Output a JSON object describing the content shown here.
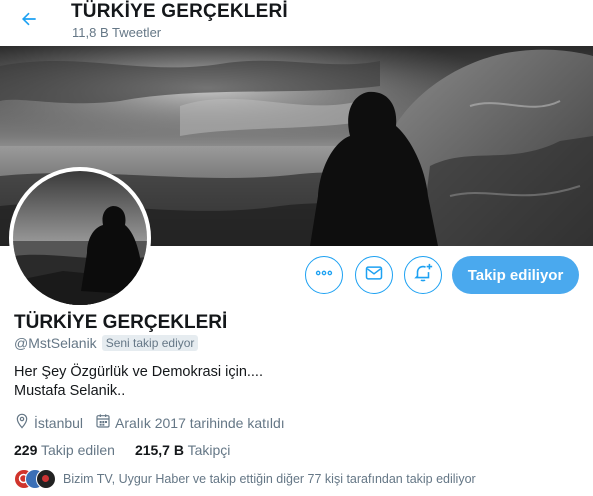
{
  "header": {
    "title": "TÜRKİYE GERÇEKLERİ",
    "tweet_count": "11,8 B Tweetler"
  },
  "profile": {
    "display_name": "TÜRKİYE GERÇEKLERİ",
    "handle": "@MstSelanik",
    "follows_you": "Seni takip ediyor",
    "bio_line1": "Her Şey Özgürlük ve Demokrasi için....",
    "bio_line2": "Mustafa Selanik..",
    "location": "İstanbul",
    "joined": "Aralık 2017 tarihinde katıldı"
  },
  "stats": {
    "following_count": "229",
    "following_label": "Takip edilen",
    "followers_count": "215,7 B",
    "followers_label": "Takipçi"
  },
  "actions": {
    "follow_label": "Takip ediliyor",
    "icons": [
      "more-icon",
      "message-icon",
      "notification-add-icon"
    ]
  },
  "followed_by": {
    "text": "Bizim TV, Uygur Haber ve takip ettiğin diğer 77 kişi tarafından takip ediliyor"
  },
  "colors": {
    "accent": "#1da1f2",
    "follow_button": "#4aa9ee",
    "secondary_text": "#657786"
  }
}
